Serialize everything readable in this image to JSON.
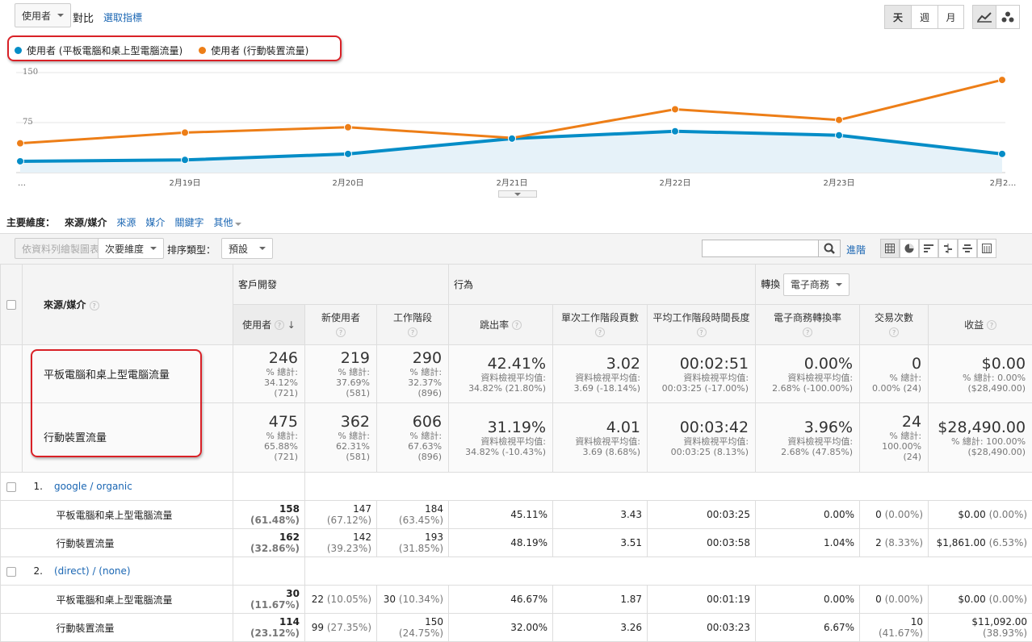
{
  "toolbar": {
    "metric_select": "使用者",
    "compare_label": "對比",
    "select_metric": "選取指標",
    "period_buttons": [
      "天",
      "週",
      "月"
    ]
  },
  "legend": {
    "series1": "使用者 (平板電腦和桌上型電腦流量)",
    "series2": "使用者 (行動裝置流量)"
  },
  "colors": {
    "series1": "#058dc7",
    "series2": "#ed7e17",
    "accent": "#1a66b3",
    "highlight": "#d92127"
  },
  "chart_data": {
    "type": "line",
    "y_ticks": [
      "150",
      "75"
    ],
    "ylim": [
      0,
      150
    ],
    "x_labels": [
      "…",
      "2月19日",
      "2月20日",
      "2月21日",
      "2月22日",
      "2月23日",
      "2月2…"
    ],
    "series": [
      {
        "name": "使用者 (平板電腦和桌上型電腦流量)",
        "values": [
          17,
          19,
          28,
          51,
          62,
          56,
          28
        ]
      },
      {
        "name": "使用者 (行動裝置流量)",
        "values": [
          44,
          60,
          68,
          52,
          95,
          79,
          139
        ]
      }
    ]
  },
  "dimension_bar": {
    "label": "主要維度：",
    "active": "來源/媒介",
    "options": [
      "來源",
      "媒介",
      "關鍵字"
    ],
    "other": "其他"
  },
  "controls": {
    "plot_rows": "依資料列繪製圖表",
    "secondary_dim": "次要維度",
    "sort_type_label": "排序類型：",
    "sort_type": "預設",
    "search_placeholder": "",
    "advanced": "進階"
  },
  "table": {
    "dim_header": "來源/媒介",
    "group_acquisition": "客戶開發",
    "group_behavior": "行為",
    "group_conversion": "轉換",
    "conversion_select": "電子商務",
    "columns": [
      "使用者",
      "新使用者",
      "工作階段",
      "跳出率",
      "單次工作階段頁數",
      "平均工作階段時間長度",
      "電子商務轉換率",
      "交易次數",
      "收益"
    ],
    "summary": [
      {
        "label": "平板電腦和桌上型電腦流量",
        "cells": [
          {
            "big": "246",
            "sub1": "% 總計:",
            "sub2": "34.12% (721)"
          },
          {
            "big": "219",
            "sub1": "% 總計:",
            "sub2": "37.69% (581)"
          },
          {
            "big": "290",
            "sub1": "% 總計:",
            "sub2": "32.37% (896)"
          },
          {
            "big": "42.41%",
            "sub1": "資料檢視平均值:",
            "sub2": "34.82% (21.80%)"
          },
          {
            "big": "3.02",
            "sub1": "資料檢視平均值:",
            "sub2": "3.69 (-18.14%)"
          },
          {
            "big": "00:02:51",
            "sub1": "資料檢視平均值:",
            "sub2": "00:03:25 (-17.00%)"
          },
          {
            "big": "0.00%",
            "sub1": "資料檢視平均值:",
            "sub2": "2.68% (-100.00%)"
          },
          {
            "big": "0",
            "sub1": "% 總計:",
            "sub2": "0.00% (24)"
          },
          {
            "big": "$0.00",
            "sub1": "% 總計: 0.00%",
            "sub2": "($28,490.00)"
          }
        ]
      },
      {
        "label": "行動裝置流量",
        "cells": [
          {
            "big": "475",
            "sub1": "% 總計:",
            "sub2": "65.88% (721)"
          },
          {
            "big": "362",
            "sub1": "% 總計:",
            "sub2": "62.31% (581)"
          },
          {
            "big": "606",
            "sub1": "% 總計:",
            "sub2": "67.63% (896)"
          },
          {
            "big": "31.19%",
            "sub1": "資料檢視平均值:",
            "sub2": "34.82% (-10.43%)"
          },
          {
            "big": "4.01",
            "sub1": "資料檢視平均值:",
            "sub2": "3.69 (8.68%)"
          },
          {
            "big": "00:03:42",
            "sub1": "資料檢視平均值:",
            "sub2": "00:03:25 (8.13%)"
          },
          {
            "big": "3.96%",
            "sub1": "資料檢視平均值:",
            "sub2": "2.68% (47.85%)"
          },
          {
            "big": "24",
            "sub1": "% 總計:",
            "sub2": "100.00%",
            "sub3": "(24)"
          },
          {
            "big": "$28,490.00",
            "sub1": "% 總計: 100.00%",
            "sub2": "($28,490.00)"
          }
        ]
      }
    ],
    "groups": [
      {
        "index": "1.",
        "name": "google / organic",
        "rows": [
          {
            "label": "平板電腦和桌上型電腦流量",
            "users": "158",
            "users_pct": "(61.48%)",
            "new": "147",
            "new_pct": "(67.12%)",
            "sessions": "184",
            "sessions_pct": "(63.45%)",
            "bounce": "45.11%",
            "pages": "3.43",
            "duration": "00:03:25",
            "conv": "0.00%",
            "tx": "0",
            "tx_pct": "(0.00%)",
            "rev": "$0.00",
            "rev_pct": "(0.00%)"
          },
          {
            "label": "行動裝置流量",
            "users": "162",
            "users_pct": "(32.86%)",
            "new": "142",
            "new_pct": "(39.23%)",
            "sessions": "193",
            "sessions_pct": "(31.85%)",
            "bounce": "48.19%",
            "pages": "3.51",
            "duration": "00:03:58",
            "conv": "1.04%",
            "tx": "2",
            "tx_pct": "(8.33%)",
            "rev": "$1,861.00",
            "rev_pct": "(6.53%)"
          }
        ]
      },
      {
        "index": "2.",
        "name": "(direct) / (none)",
        "rows": [
          {
            "label": "平板電腦和桌上型電腦流量",
            "users": "30",
            "users_pct": "(11.67%)",
            "new": "22",
            "new_pct": "(10.05%)",
            "sessions": "30",
            "sessions_pct": "(10.34%)",
            "bounce": "46.67%",
            "pages": "1.87",
            "duration": "00:01:19",
            "conv": "0.00%",
            "tx": "0",
            "tx_pct": "(0.00%)",
            "rev": "$0.00",
            "rev_pct": "(0.00%)"
          },
          {
            "label": "行動裝置流量",
            "users": "114",
            "users_pct": "(23.12%)",
            "new": "99",
            "new_pct": "(27.35%)",
            "sessions": "150",
            "sessions_pct": "(24.75%)",
            "bounce": "32.00%",
            "pages": "3.26",
            "duration": "00:03:23",
            "conv": "6.67%",
            "tx": "10",
            "tx_pct": "(41.67%)",
            "rev": "$11,092.00",
            "rev_pct": "(38.93%)"
          }
        ]
      }
    ]
  }
}
